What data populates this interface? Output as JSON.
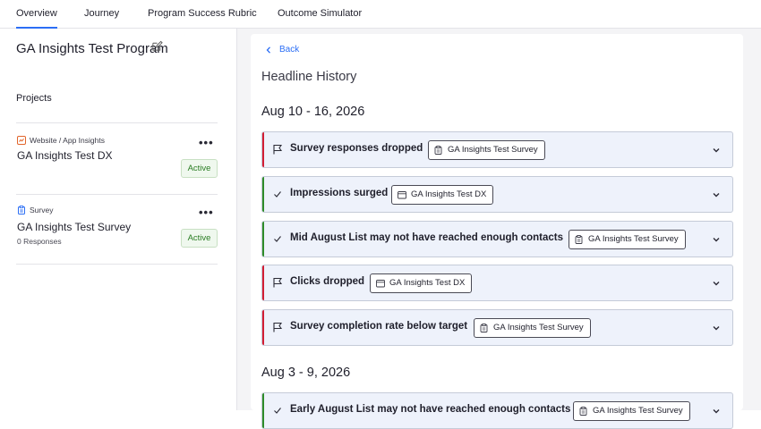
{
  "tabs": [
    "Overview",
    "Journey",
    "Program Success Rubric",
    "Outcome Simulator"
  ],
  "sidebar": {
    "program_title": "GA Insights Test Program",
    "projects_label": "Projects",
    "projects": [
      {
        "type": "Website / App Insights",
        "name": "GA Insights Test DX",
        "sub": "",
        "status": "Active",
        "icon": "website-insights-icon"
      },
      {
        "type": "Survey",
        "name": "GA Insights Test Survey",
        "sub": "0 Responses",
        "status": "Active",
        "icon": "survey-icon"
      }
    ]
  },
  "main": {
    "back_label": "Back",
    "heading": "Headline History",
    "weeks": [
      {
        "label": "Aug 10 - 16, 2026",
        "items": [
          {
            "title": "Survey responses dropped",
            "tag": "GA Insights Test Survey",
            "tag_type": "survey",
            "kind": "negative"
          },
          {
            "title": "Impressions surged",
            "tag": "GA Insights Test DX",
            "tag_type": "website",
            "kind": "positive"
          },
          {
            "title": "Mid August List may not have reached enough contacts",
            "tag": "GA Insights Test Survey",
            "tag_type": "survey",
            "kind": "positive"
          },
          {
            "title": "Clicks dropped",
            "tag": "GA Insights Test DX",
            "tag_type": "website",
            "kind": "negative"
          },
          {
            "title": "Survey completion rate below target",
            "tag": "GA Insights Test Survey",
            "tag_type": "survey",
            "kind": "negative"
          }
        ]
      },
      {
        "label": "Aug 3 - 9, 2026",
        "items": [
          {
            "title": "Early August List may not have reached enough contacts",
            "tag": "GA Insights Test Survey",
            "tag_type": "survey",
            "kind": "positive"
          }
        ]
      }
    ]
  },
  "colors": {
    "accent": "#2b6ef5",
    "negative": "#d21e34",
    "positive": "#2f8c2a",
    "active_badge": "#2a7d23"
  }
}
